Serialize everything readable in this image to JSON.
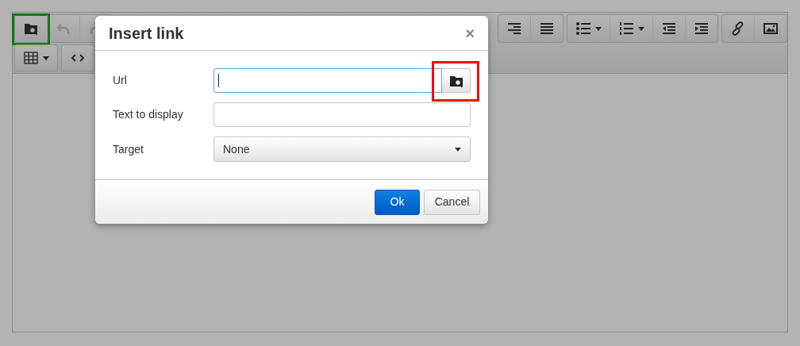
{
  "toolbar": {
    "rows": [
      [
        {
          "buttons": [
            {
              "kind": "browse",
              "has_caret": false,
              "highlighted": true,
              "color": "#0a7d0a"
            },
            {
              "kind": "undo",
              "has_caret": false,
              "highlighted": false
            },
            {
              "kind": "redo",
              "has_caret": false,
              "highlighted": false
            }
          ]
        },
        {
          "buttons": [
            {
              "kind": "align_right",
              "has_caret": false,
              "highlighted": false
            },
            {
              "kind": "justify",
              "has_caret": false,
              "highlighted": false
            }
          ]
        },
        {
          "buttons": [
            {
              "kind": "bullet_list",
              "has_caret": true,
              "highlighted": false
            },
            {
              "kind": "numbered_list",
              "has_caret": true,
              "highlighted": false
            },
            {
              "kind": "outdent",
              "has_caret": false,
              "highlighted": false
            },
            {
              "kind": "indent",
              "has_caret": false,
              "highlighted": false
            }
          ]
        },
        {
          "buttons": [
            {
              "kind": "link",
              "has_caret": false,
              "highlighted": false
            },
            {
              "kind": "image",
              "has_caret": false,
              "highlighted": false
            }
          ]
        }
      ],
      [
        {
          "buttons": [
            {
              "kind": "table",
              "has_caret": true,
              "highlighted": false
            }
          ]
        },
        {
          "buttons": [
            {
              "kind": "code",
              "has_caret": false,
              "highlighted": false
            }
          ]
        }
      ]
    ]
  },
  "dialog": {
    "title": "Insert link",
    "close": "×",
    "fields": [
      {
        "label": "Url",
        "kind": "browse_input",
        "focused": true,
        "highlighted": true,
        "color": "#ff0000"
      },
      {
        "label": "Text to display",
        "kind": "text",
        "focused": false
      },
      {
        "label": "Target",
        "kind": "select",
        "value": "None",
        "focused": false
      }
    ],
    "buttons": [
      {
        "label": "Ok",
        "primary": true
      },
      {
        "label": "Cancel",
        "primary": false
      }
    ]
  }
}
